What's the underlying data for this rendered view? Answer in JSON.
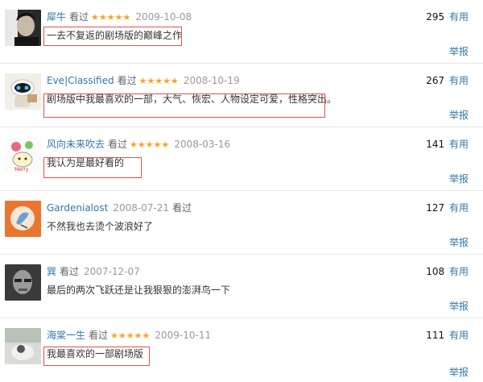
{
  "reviews": [
    {
      "user": "犀牛",
      "status": "看过",
      "stars": "★★★★★",
      "date": "2009-10-08",
      "text": "一去不复返的剧场版的巅峰之作",
      "votes": "295",
      "useful": "有用",
      "report": "举报",
      "highlighted": true,
      "avatar": "man-portrait-avatar"
    },
    {
      "user": "Eve|Classified",
      "status": "看过",
      "stars": "★★★★★",
      "date": "2008-10-19",
      "text": "剧场版中我最喜欢的一部，大气、恢宏、人物设定可爱，性格突出。",
      "votes": "267",
      "useful": "有用",
      "report": "举报",
      "highlighted": true,
      "avatar": "robot-avatar"
    },
    {
      "user": "风向未来吹去",
      "status": "看过",
      "stars": "★★★★★",
      "date": "2008-03-16",
      "text": "我认为是最好看的",
      "votes": "141",
      "useful": "有用",
      "report": "举报",
      "highlighted": true,
      "avatar": "cartoon-avatar"
    },
    {
      "user": "Gardenialost",
      "status": "看过",
      "stars": "",
      "date": "2008-07-21",
      "text": "不然我也去烫个波浪好了",
      "votes": "127",
      "useful": "有用",
      "report": "举报",
      "highlighted": false,
      "avatar": "orange-drawing-avatar"
    },
    {
      "user": "巽",
      "status": "看过",
      "stars": "",
      "date": "2007-12-07",
      "text": "最后的两次飞跃还是让我狠狠的澎湃鸟一下",
      "votes": "108",
      "useful": "有用",
      "report": "举报",
      "highlighted": false,
      "avatar": "bw-face-avatar"
    },
    {
      "user": "海棠一生",
      "status": "看过",
      "stars": "★★★★★",
      "date": "2009-10-11",
      "text": "我最喜欢的一部剧场版",
      "votes": "111",
      "useful": "有用",
      "report": "举报",
      "highlighted": true,
      "avatar": "photo-avatar"
    }
  ],
  "colors": {
    "link": "#3377aa",
    "star": "#f5a623",
    "highlight": "#d9534f",
    "date": "#999999"
  }
}
